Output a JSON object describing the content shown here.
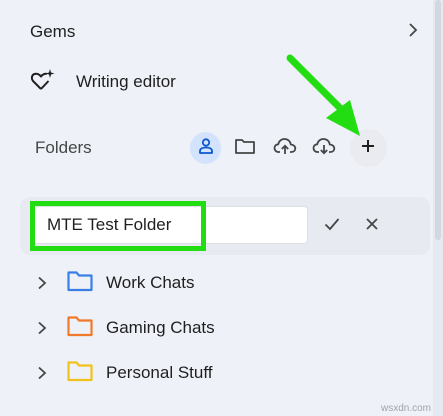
{
  "gems": {
    "title": "Gems",
    "chevron_icon": "chevron-right-icon",
    "items": [
      {
        "label": "Writing editor",
        "icon": "sparkle-heart-icon"
      }
    ]
  },
  "folders": {
    "title": "Folders",
    "toolbar": [
      {
        "name": "person-icon",
        "active": true
      },
      {
        "name": "folder-icon",
        "active": false
      },
      {
        "name": "cloud-upload-icon",
        "active": false
      },
      {
        "name": "cloud-download-icon",
        "active": false
      },
      {
        "name": "plus-icon",
        "active": false
      }
    ],
    "new_folder": {
      "value": "MTE Test Folder",
      "confirm_icon": "check-icon",
      "cancel_icon": "close-icon"
    },
    "items": [
      {
        "label": "Work Chats",
        "color": "#3b7fe6"
      },
      {
        "label": "Gaming Chats",
        "color": "#f07a2a"
      },
      {
        "label": "Personal Stuff",
        "color": "#f1c21b"
      }
    ]
  },
  "annotations": {
    "arrow_color": "#22dd11",
    "highlight_color": "#22dd11"
  },
  "watermark": "wsxdn.com"
}
